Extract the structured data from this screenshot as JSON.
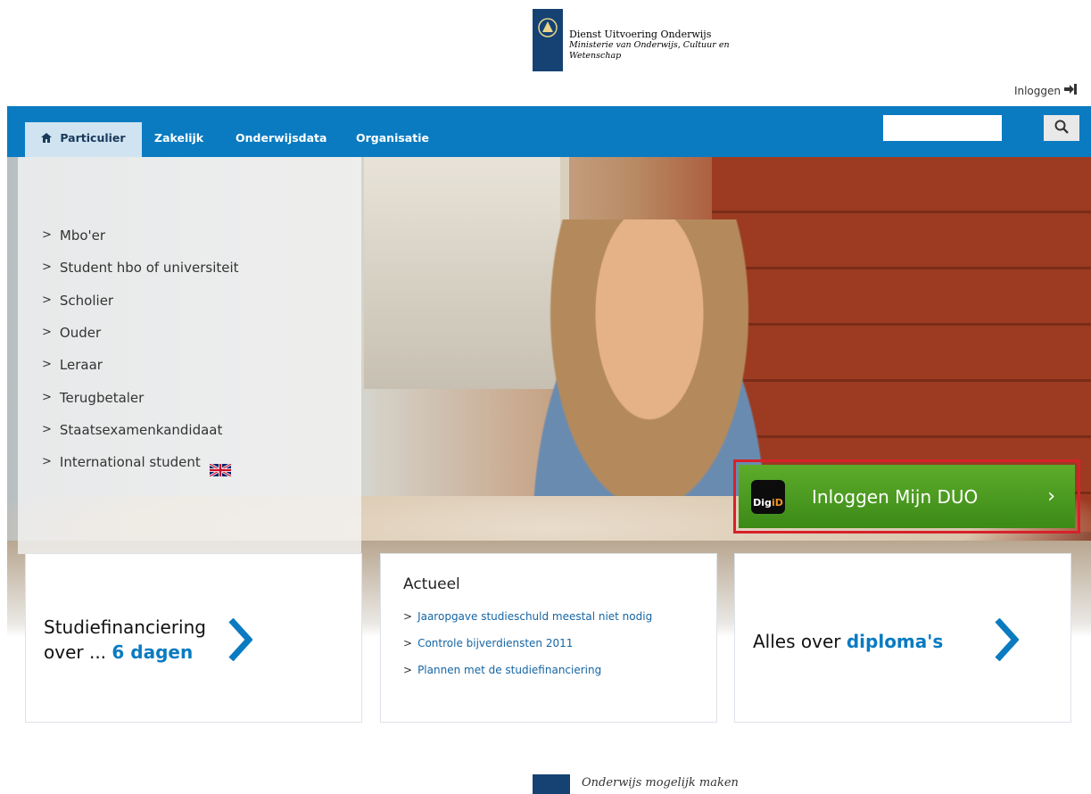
{
  "header": {
    "logo_line1": "Dienst Uitvoering Onderwijs",
    "logo_line2": "Ministerie van Onderwijs, Cultuur en",
    "logo_line3": "Wetenschap",
    "login_label": "Inloggen"
  },
  "nav": {
    "items": [
      {
        "label": "Particulier",
        "active": true
      },
      {
        "label": "Zakelijk"
      },
      {
        "label": "Onderwijsdata"
      },
      {
        "label": "Organisatie"
      }
    ],
    "search_placeholder": ""
  },
  "side_menu": {
    "items": [
      {
        "label": "Mbo'er"
      },
      {
        "label": "Student hbo of universiteit"
      },
      {
        "label": "Scholier"
      },
      {
        "label": "Ouder"
      },
      {
        "label": "Leraar"
      },
      {
        "label": "Terugbetaler"
      },
      {
        "label": "Staatsexamenkandidaat"
      },
      {
        "label": "International student"
      }
    ]
  },
  "duo_login": {
    "digid_part1": "Dig",
    "digid_part2": "iD",
    "label": "Inloggen Mijn DUO",
    "arrow": "›"
  },
  "cards": {
    "studiefinanciering": {
      "line1": "Studiefinanciering",
      "line2_prefix": "over ... ",
      "line2_highlight": "6 dagen"
    },
    "actueel": {
      "title": "Actueel",
      "links": [
        {
          "label": "Jaaropgave studieschuld meestal niet nodig"
        },
        {
          "label": "Controle bijverdiensten 2011"
        },
        {
          "label": "Plannen met de studiefinanciering"
        }
      ]
    },
    "diplomas": {
      "prefix": "Alles over ",
      "highlight": "diploma's"
    }
  },
  "footer": {
    "tagline": "Onderwijs mogelijk maken"
  },
  "colors": {
    "brand_blue": "#0a7bc1",
    "rijksoverheid_blue": "#154273",
    "login_green": "#4a9a1f",
    "highlight_red": "#d6222a"
  }
}
